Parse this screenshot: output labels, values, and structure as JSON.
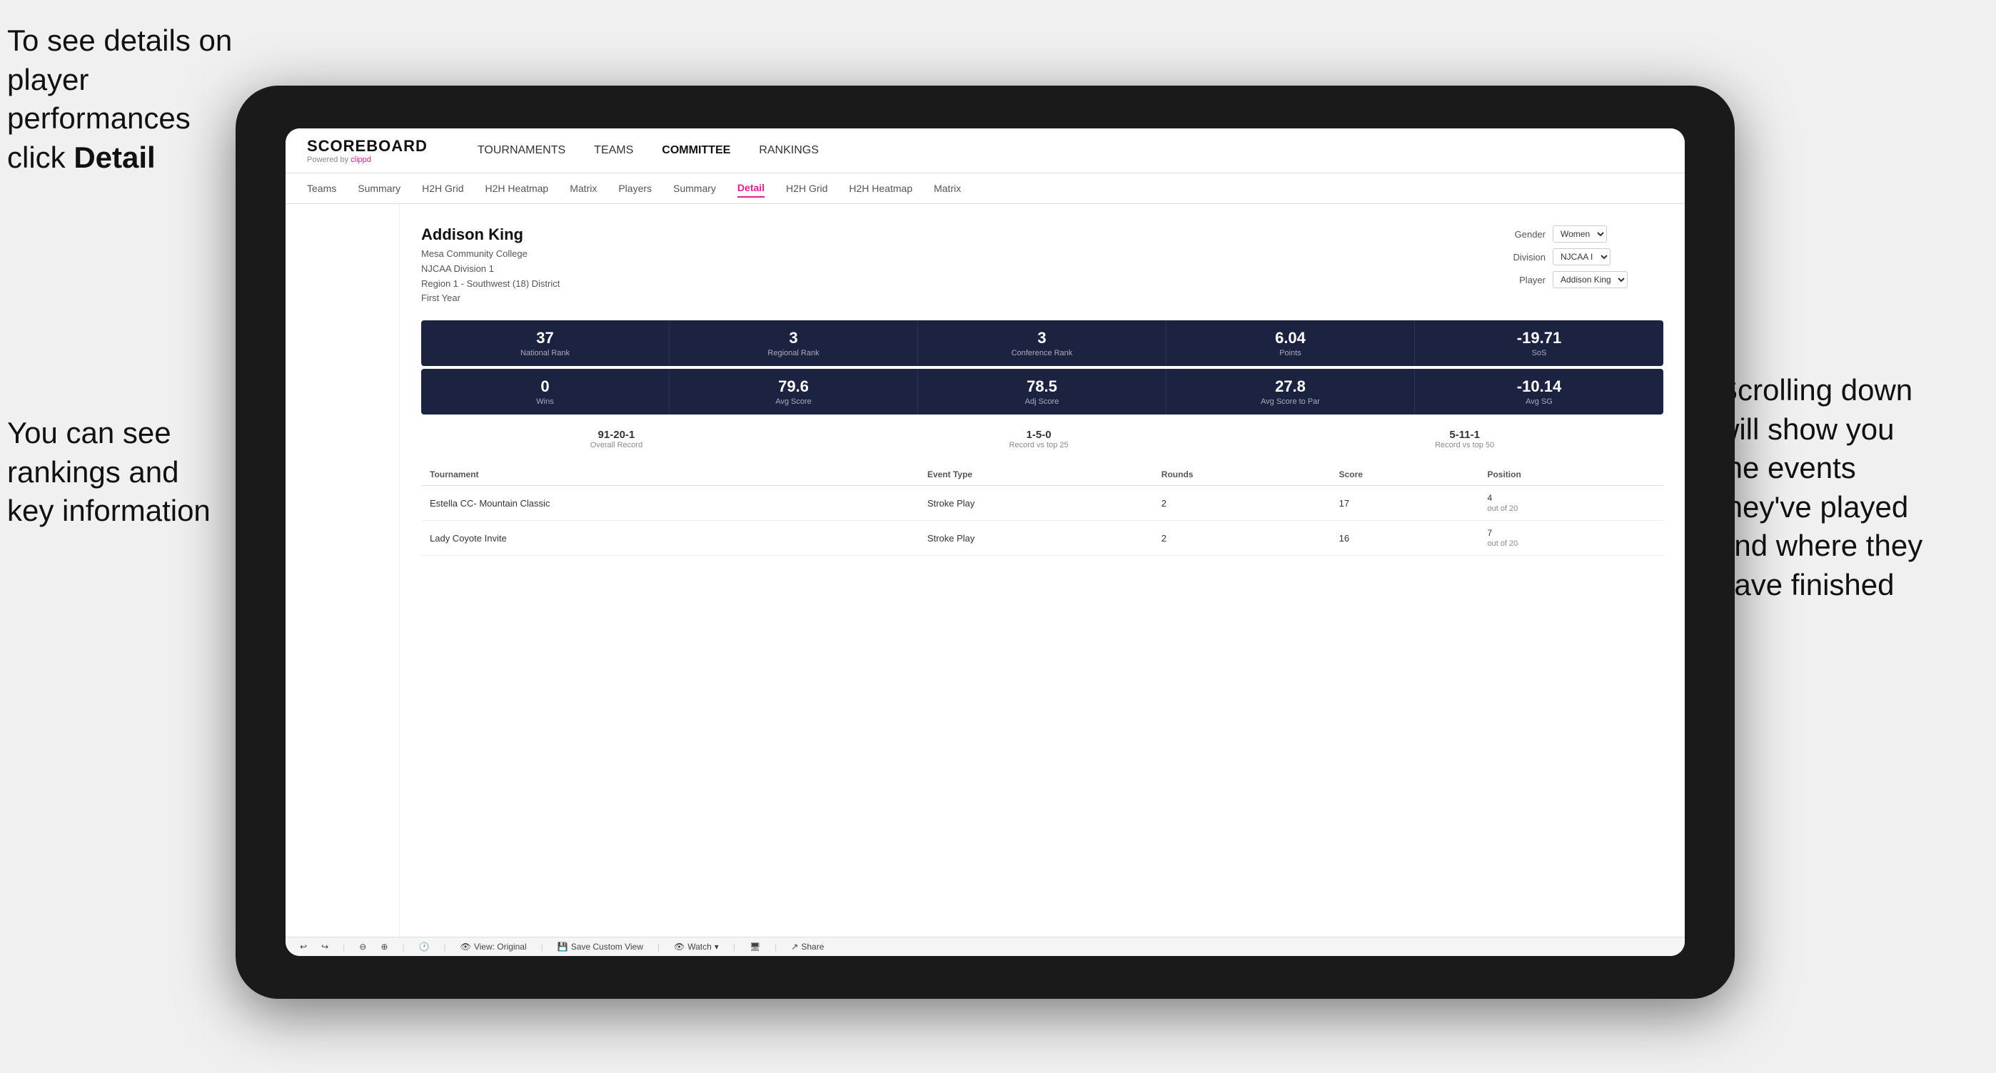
{
  "annotations": {
    "topleft_line1": "To see details on",
    "topleft_line2": "player performances",
    "topleft_line3": "click ",
    "topleft_bold": "Detail",
    "bottomleft_line1": "You can see",
    "bottomleft_line2": "rankings and",
    "bottomleft_line3": "key information",
    "bottomright_line1": "Scrolling down",
    "bottomright_line2": "will show you",
    "bottomright_line3": "the events",
    "bottomright_line4": "they've played",
    "bottomright_line5": "and where they",
    "bottomright_line6": "have finished"
  },
  "nav": {
    "logo": "SCOREBOARD",
    "logo_sub": "Powered by clippd",
    "items": [
      {
        "label": "TOURNAMENTS",
        "active": false
      },
      {
        "label": "TEAMS",
        "active": false
      },
      {
        "label": "COMMITTEE",
        "active": false
      },
      {
        "label": "RANKINGS",
        "active": false
      }
    ]
  },
  "subnav": {
    "items": [
      {
        "label": "Teams",
        "active": false
      },
      {
        "label": "Summary",
        "active": false
      },
      {
        "label": "H2H Grid",
        "active": false
      },
      {
        "label": "H2H Heatmap",
        "active": false
      },
      {
        "label": "Matrix",
        "active": false
      },
      {
        "label": "Players",
        "active": false
      },
      {
        "label": "Summary",
        "active": false
      },
      {
        "label": "Detail",
        "active": true
      },
      {
        "label": "H2H Grid",
        "active": false
      },
      {
        "label": "H2H Heatmap",
        "active": false
      },
      {
        "label": "Matrix",
        "active": false
      }
    ]
  },
  "player": {
    "name": "Addison King",
    "school": "Mesa Community College",
    "division": "NJCAA Division 1",
    "region": "Region 1 - Southwest (18) District",
    "year": "First Year"
  },
  "filters": {
    "gender_label": "Gender",
    "gender_value": "Women",
    "division_label": "Division",
    "division_value": "NJCAA I",
    "player_label": "Player",
    "player_value": "Addison King"
  },
  "stats_row1": [
    {
      "value": "37",
      "label": "National Rank"
    },
    {
      "value": "3",
      "label": "Regional Rank"
    },
    {
      "value": "3",
      "label": "Conference Rank"
    },
    {
      "value": "6.04",
      "label": "Points"
    },
    {
      "value": "-19.71",
      "label": "SoS"
    }
  ],
  "stats_row2": [
    {
      "value": "0",
      "label": "Wins"
    },
    {
      "value": "79.6",
      "label": "Avg Score"
    },
    {
      "value": "78.5",
      "label": "Adj Score"
    },
    {
      "value": "27.8",
      "label": "Avg Score to Par"
    },
    {
      "value": "-10.14",
      "label": "Avg SG"
    }
  ],
  "records": [
    {
      "value": "91-20-1",
      "label": "Overall Record"
    },
    {
      "value": "1-5-0",
      "label": "Record vs top 25"
    },
    {
      "value": "5-11-1",
      "label": "Record vs top 50"
    }
  ],
  "table": {
    "headers": [
      "Tournament",
      "Event Type",
      "Rounds",
      "Score",
      "Position"
    ],
    "rows": [
      {
        "tournament": "Estella CC- Mountain Classic",
        "event_type": "Stroke Play",
        "rounds": "2",
        "score": "17",
        "position": "4\nout of 20"
      },
      {
        "tournament": "Lady Coyote Invite",
        "event_type": "Stroke Play",
        "rounds": "2",
        "score": "16",
        "position": "7\nout of 20"
      }
    ]
  },
  "toolbar": {
    "view_original": "View: Original",
    "save_custom": "Save Custom View",
    "watch": "Watch",
    "share": "Share"
  }
}
